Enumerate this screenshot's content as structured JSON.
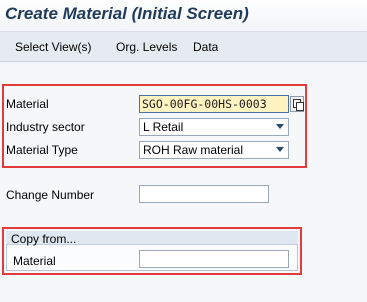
{
  "window": {
    "title": "Create Material (Initial Screen)"
  },
  "menu": {
    "items": [
      "Select View(s)",
      "Org. Levels",
      "Data"
    ]
  },
  "form": {
    "material": {
      "label": "Material",
      "value": "SGO-00FG-00HS-0003"
    },
    "industry_sector": {
      "label": "Industry sector",
      "value": "L Retail"
    },
    "material_type": {
      "label": "Material Type",
      "value": "ROH Raw material"
    },
    "change_number": {
      "label": "Change Number",
      "value": ""
    }
  },
  "copy_from": {
    "title": "Copy from...",
    "material": {
      "label": "Material",
      "value": ""
    }
  },
  "icons": {
    "copy": "copy-icon",
    "dropdown": "chevron-down-icon"
  },
  "colors": {
    "highlight_border": "#e23b3b",
    "input_focus_bg": "#fff3c2",
    "title_text": "#1f3a5a"
  }
}
